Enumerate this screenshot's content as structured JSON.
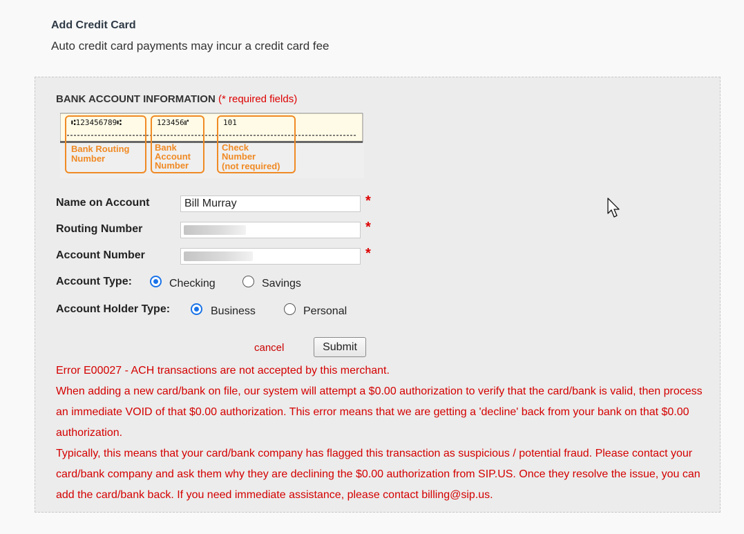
{
  "header": {
    "title": "Add Credit Card",
    "subtitle": "Auto credit card payments may incur a credit card fee"
  },
  "section": {
    "heading": "BANK ACCOUNT INFORMATION",
    "required_note": "(* required fields)"
  },
  "check_image": {
    "routing_digits": "⑆123456789⑆",
    "account_digits": "123456⑈",
    "check_digits": "101",
    "routing_label": [
      "Bank Routing",
      "Number"
    ],
    "account_label": [
      "Bank",
      "Account",
      "Number"
    ],
    "check_label": [
      "Check",
      "Number",
      "(not required)"
    ],
    "accent_color": "#f08a24"
  },
  "form": {
    "name_label": "Name on Account",
    "name_value": "Bill Murray",
    "routing_label": "Routing Number",
    "account_label": "Account Number",
    "required_mark": "*",
    "account_type_label": "Account Type:",
    "account_type_options": [
      "Checking",
      "Savings"
    ],
    "account_type_selected": "Checking",
    "holder_type_label": "Account Holder Type:",
    "holder_type_options": [
      "Business",
      "Personal"
    ],
    "holder_type_selected": "Business",
    "cancel_label": "cancel",
    "submit_label": "Submit"
  },
  "error": {
    "code_line": "Error E00027 - ACH transactions are not accepted by this merchant.",
    "paragraph1": "When adding a new card/bank on file, our system will attempt a $0.00 authorization to verify that the card/bank is valid, then process an immediate VOID of that $0.00 authorization. This error means that we are getting a 'decline' back from your bank on that $0.00 authorization.",
    "paragraph2": "Typically, this means that your card/bank company has flagged this transaction as suspicious / potential fraud. Please contact your card/bank company and ask them why they are declining the $0.00 authorization from SIP.US. Once they resolve the issue, you can add the card/bank back. If you need immediate assistance, please contact billing@sip.us."
  },
  "colors": {
    "error_red": "#d40000",
    "radio_blue": "#1a73e8",
    "panel_bg": "#ececec"
  }
}
